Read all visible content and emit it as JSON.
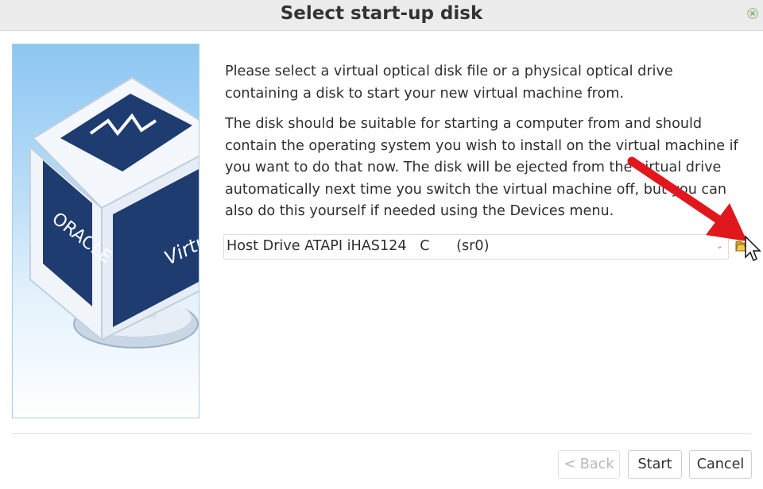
{
  "window": {
    "title": "Select start-up disk",
    "close_glyph": "×"
  },
  "content": {
    "paragraph1": "Please select a virtual optical disk file or a physical optical drive containing a disk to start your new virtual machine from.",
    "paragraph2": "The disk should be suitable for starting a computer from and should contain the operating system you wish to install on the virtual machine if you want to do that now. The disk will be ejected from the virtual drive automatically next time you switch the virtual machine off, but you can also do this yourself if needed using the Devices menu."
  },
  "disk_select": {
    "value": "Host Drive ATAPI iHAS124   C      (sr0)",
    "arrow_glyph": "⌄"
  },
  "logo": {
    "brand": "ORACLE",
    "product_text": "Virtu"
  },
  "buttons": {
    "back": "< Back",
    "start": "Start",
    "cancel": "Cancel"
  },
  "icons": {
    "folder": "folder-open-icon",
    "cursor": "mouse-pointer-icon",
    "arrow": "red-arrow-annotation"
  },
  "colors": {
    "annotation_arrow": "#e0171c",
    "titlebar": "#ececec",
    "cube_dark": "#1e3c70"
  }
}
